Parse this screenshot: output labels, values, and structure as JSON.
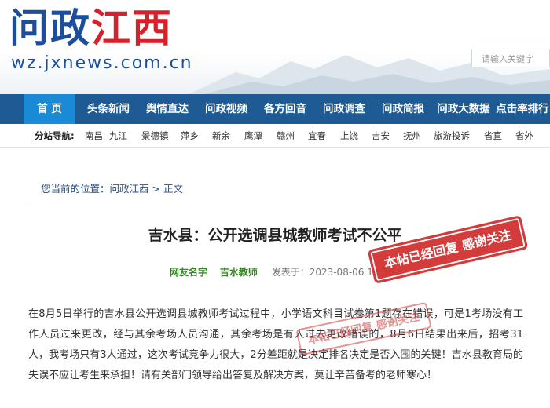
{
  "header": {
    "logo_part1": "问政",
    "logo_part2": "江西",
    "logo_url": "wz.jxnews.com.cn",
    "search_placeholder": "请输入关键字"
  },
  "nav": {
    "items": [
      "首 页",
      "头条新闻",
      "舆情直达",
      "问政视频",
      "各方回音",
      "问政调查",
      "问政简报",
      "问政大数据",
      "点击率排行"
    ]
  },
  "subnav": {
    "label": "分站导航:",
    "items": [
      "南昌",
      "九江",
      "景德镇",
      "萍乡",
      "新余",
      "鹰潭",
      "赣州",
      "宜春",
      "上饶",
      "吉安",
      "抚州",
      "旅游投诉",
      "省直",
      "省外"
    ]
  },
  "breadcrumb": {
    "prefix": "您当前的位置：",
    "site": "问政江西",
    "sep": " > ",
    "current": "正文"
  },
  "article": {
    "title": "吉水县：公开选调县城教师考试不公平",
    "user_label": "网友名字",
    "target_label": "吉水教师",
    "time": "发表于：2023-08-06 12:36",
    "body": "在8月5日举行的吉水县公开选调县城教师考试过程中，小学语文科目试卷第1题存在错误，可是1考场没有工作人员过来更改，经与其余考场人员沟通，其余考场是有人过去更改错误的，8月6日结果出来后，招考31人，我考场只有3人通过，这次考试竞争力很大，2分差距就是决定排名决定是否入围的关键！吉水县教育局的失误不应让考生来承担！请有关部门领导给出答复及解决方案，莫让辛苦备考的老师寒心！"
  },
  "stamps": {
    "main": "本帖已经回复 感谢关注",
    "faded": "本帖已经回复 感谢关注"
  }
}
